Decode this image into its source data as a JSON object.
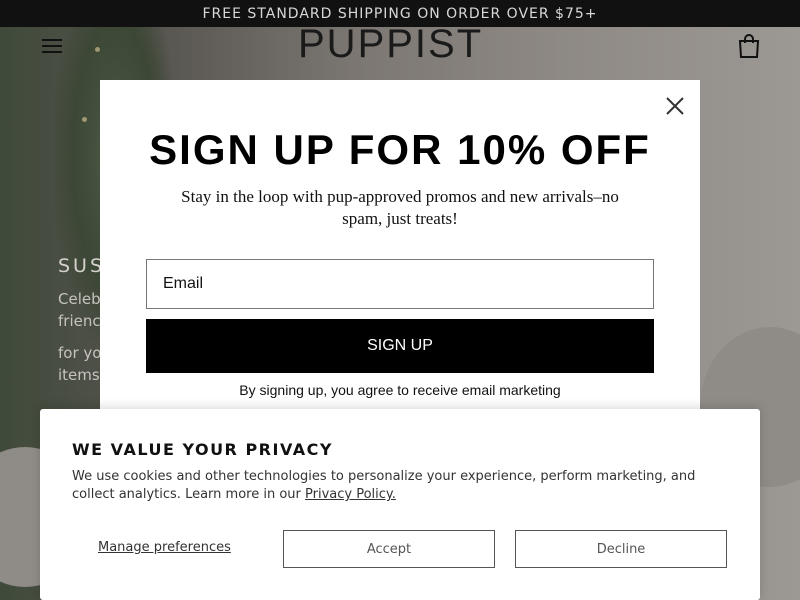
{
  "announcement": {
    "text": "FREE STANDARD SHIPPING ON ORDER OVER $75+"
  },
  "header": {
    "logo_text": "PUPPIST",
    "menu_icon": "hamburger-icon",
    "cart_icon": "shopping-bag-icon"
  },
  "hero": {
    "heading": "SUS",
    "paragraph_1": "Celeb\nfrienc",
    "paragraph_2": "for yo\nitems"
  },
  "modal": {
    "title": "SIGN UP FOR 10% OFF",
    "subtitle": "Stay in the loop with pup-approved promos and new arrivals–no spam, just treats!",
    "email_placeholder": "Email",
    "button_label": "SIGN UP",
    "consent_text": "By signing up, you agree to receive email marketing",
    "close_icon": "close-icon"
  },
  "privacy": {
    "title": "WE VALUE YOUR PRIVACY",
    "body_text": "We use cookies and other technologies to personalize your experience, perform marketing, and collect analytics. Learn more in our ",
    "policy_link": "Privacy Policy.",
    "manage_label": "Manage preferences",
    "accept_label": "Accept",
    "decline_label": "Decline"
  },
  "colors": {
    "announcement_bg": "#111111",
    "button_bg": "#000000",
    "modal_bg": "#ffffff"
  }
}
